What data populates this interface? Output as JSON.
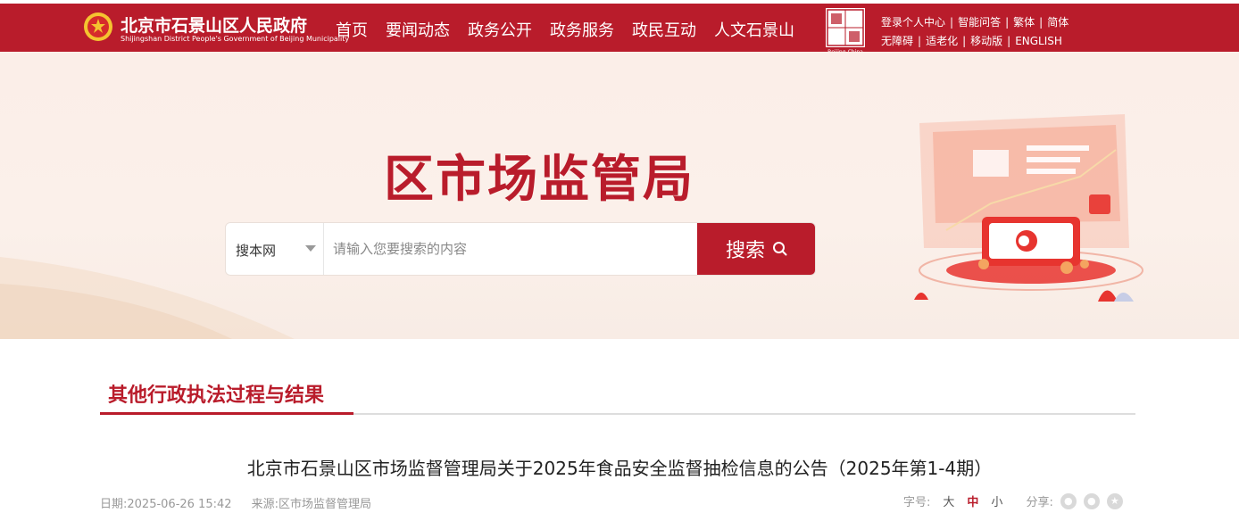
{
  "header": {
    "site_name": "北京市石景山区人民政府",
    "site_subtitle": "Shijingshan District People's Government of Beijing Municipality",
    "nav": [
      "首页",
      "要闻动态",
      "政务公开",
      "政务服务",
      "政民互动",
      "人文石景山"
    ],
    "stamp_text": "Beijing-China",
    "links_row1": [
      "登录个人中心",
      "智能问答",
      "繁体",
      "简体"
    ],
    "links_row2": [
      "无障碍",
      "适老化",
      "移动版",
      "ENGLISH"
    ]
  },
  "banner": {
    "title": "区市场监管局",
    "search_scope": "搜本网",
    "search_placeholder": "请输入您要搜索的内容",
    "search_button": "搜索"
  },
  "section": {
    "title": "其他行政执法过程与结果"
  },
  "article": {
    "title": "北京市石景山区市场监督管理局关于2025年食品安全监督抽检信息的公告（2025年第1-4期）",
    "date": "日期:2025-06-26 15:42",
    "source": "来源:区市场监督管理局",
    "font_size_label": "字号:",
    "font_sizes": [
      "大",
      "中",
      "小"
    ],
    "share_label": "分享:"
  },
  "colors": {
    "brand_red": "#b91c2b"
  }
}
